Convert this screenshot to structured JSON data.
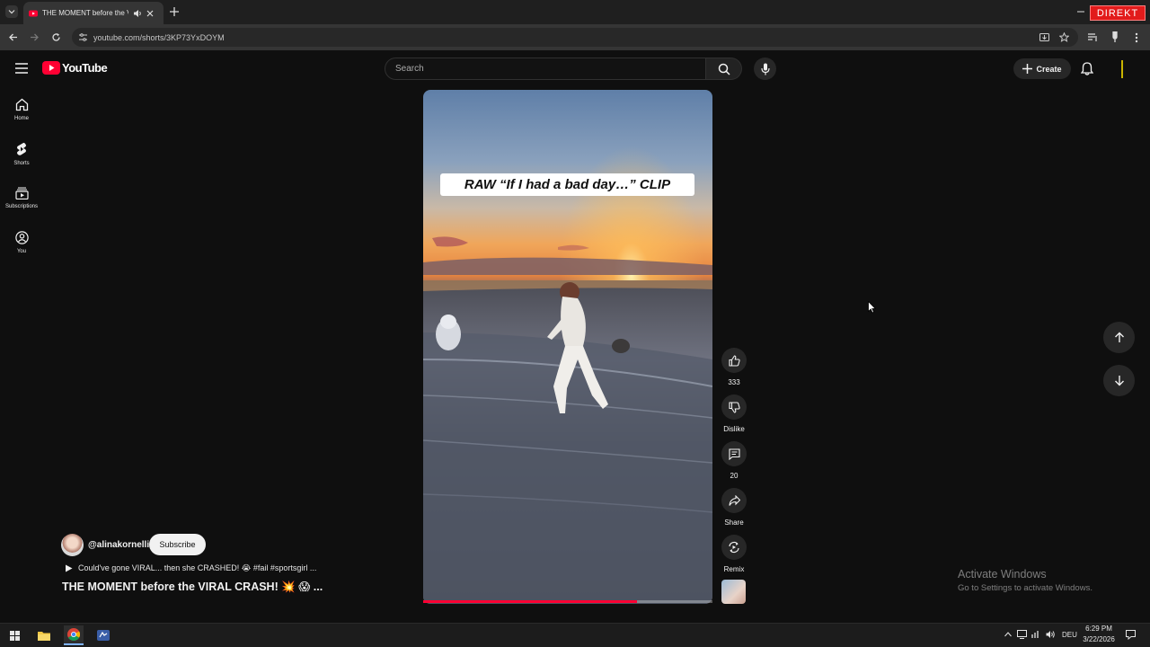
{
  "browser": {
    "tab_title": "THE MOMENT before the VIRAL CRASH!",
    "url": "youtube.com/shorts/3KP73YxDOYM",
    "overlay_badge": "DIREKT"
  },
  "youtube": {
    "logo_text": "YouTube",
    "search_placeholder": "Search",
    "create_label": "Create"
  },
  "sidebar": {
    "items": [
      {
        "label": "Home",
        "icon": "home-icon"
      },
      {
        "label": "Shorts",
        "icon": "shorts-icon"
      },
      {
        "label": "Subscriptions",
        "icon": "subscriptions-icon"
      },
      {
        "label": "You",
        "icon": "you-icon"
      }
    ]
  },
  "short": {
    "overlay_text": "RAW “If I had a bad day…” CLIP",
    "progress_fraction": 0.74,
    "channel": "@alinakornelli",
    "subscribe_label": "Subscribe",
    "description": "Could've gone VIRAL... then she CRASHED! 😭 #fail #sportsgirl ...",
    "title": "THE MOMENT before the VIRAL CRASH! 💥 😱",
    "more": "..."
  },
  "actions": {
    "like_count": "333",
    "dislike_label": "Dislike",
    "comment_count": "20",
    "share_label": "Share",
    "remix_label": "Remix"
  },
  "watermark": {
    "line1": "Activate Windows",
    "line2": "Go to Settings to activate Windows."
  },
  "taskbar": {
    "language": "DEU",
    "time": "6:29 PM",
    "date": "3/22/2026"
  },
  "colors": {
    "accent_red": "#ff0033",
    "background": "#0f0f0f"
  }
}
